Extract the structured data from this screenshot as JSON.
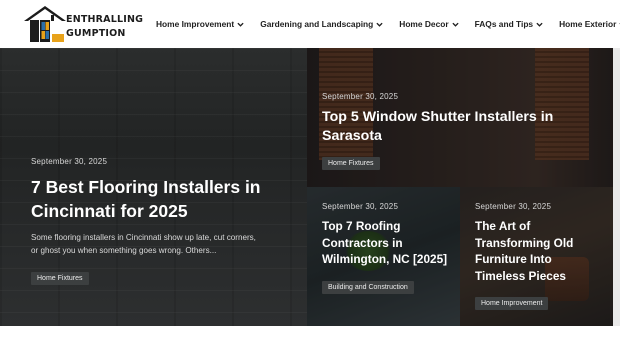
{
  "site": {
    "logo_line1": "ENTHRALLING",
    "logo_line2": "GUMPTION",
    "logo_icon": "house-logo-icon"
  },
  "nav": {
    "items": [
      {
        "label": "Home Improvement",
        "icon": "chevron-down-icon"
      },
      {
        "label": "Gardening and Landscaping",
        "icon": "chevron-down-icon"
      },
      {
        "label": "Home Decor",
        "icon": "chevron-down-icon"
      },
      {
        "label": "FAQs and Tips",
        "icon": "chevron-down-icon"
      },
      {
        "label": "Home Exterior",
        "icon": "chevron-down-icon"
      }
    ]
  },
  "featured": {
    "main": {
      "date": "September 30, 2025",
      "title": "7 Best Flooring Installers in Cincinnati for 2025",
      "excerpt": "Some flooring installers in Cincinnati show up late, cut corners, or ghost you when something goes wrong. Others...",
      "tag": "Home Fixtures"
    },
    "top_right": {
      "date": "September 30, 2025",
      "title": "Top 5 Window Shutter Installers in Sarasota",
      "tag": "Home Fixtures"
    },
    "bottom_left": {
      "date": "September 30, 2025",
      "title": "Top 7 Roofing Contractors in Wilmington, NC [2025]",
      "tag": "Building and Construction"
    },
    "bottom_right": {
      "date": "September 30, 2025",
      "title": "The Art of Transforming Old Furniture Into Timeless Pieces",
      "tag": "Home Improvement"
    }
  },
  "colors": {
    "accent_dark": "#1f1f1f",
    "logo_yellow": "#e8a21a",
    "logo_blue": "#2d6fa8"
  }
}
